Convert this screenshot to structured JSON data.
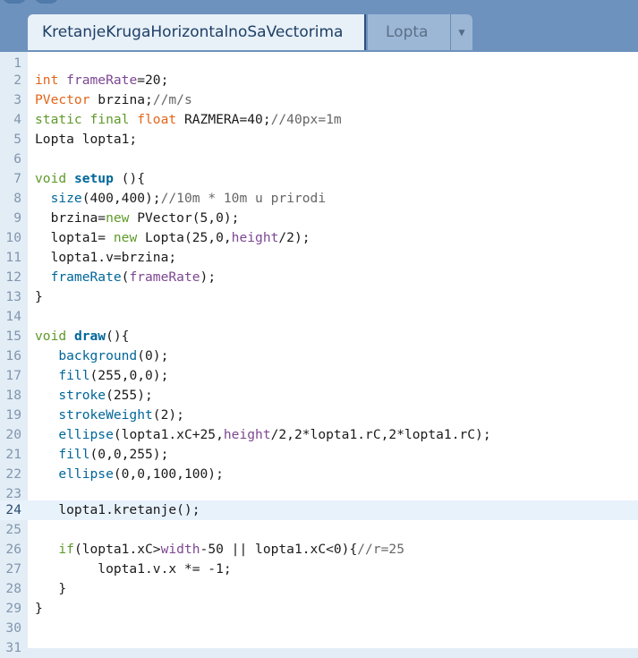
{
  "tabs": {
    "active": "KretanjeKrugaHorizontalnoSaVectorima",
    "inactive": "Lopta",
    "menu_glyph": "▼"
  },
  "code_lines": [
    {
      "n": "1",
      "text": ""
    },
    {
      "n": "2",
      "text": "int frameRate=20;"
    },
    {
      "n": "3",
      "text": "PVector brzina;//m/s"
    },
    {
      "n": "4",
      "text": "static final float RAZMERA=40;//40px=1m"
    },
    {
      "n": "5",
      "text": "Lopta lopta1;"
    },
    {
      "n": "6",
      "text": ""
    },
    {
      "n": "7",
      "text": "void setup (){"
    },
    {
      "n": "8",
      "text": "  size(400,400);//10m * 10m u prirodi"
    },
    {
      "n": "9",
      "text": "  brzina=new PVector(5,0);"
    },
    {
      "n": "10",
      "text": "  lopta1= new Lopta(25,0,height/2);"
    },
    {
      "n": "11",
      "text": "  lopta1.v=brzina;"
    },
    {
      "n": "12",
      "text": "  frameRate(frameRate);"
    },
    {
      "n": "13",
      "text": "}"
    },
    {
      "n": "14",
      "text": ""
    },
    {
      "n": "15",
      "text": "void draw(){"
    },
    {
      "n": "16",
      "text": "   background(0);"
    },
    {
      "n": "17",
      "text": "   fill(255,0,0);"
    },
    {
      "n": "18",
      "text": "   stroke(255);"
    },
    {
      "n": "19",
      "text": "   strokeWeight(2);"
    },
    {
      "n": "20",
      "text": "   ellipse(lopta1.xC+25,height/2,2*lopta1.rC,2*lopta1.rC);"
    },
    {
      "n": "21",
      "text": "   fill(0,0,255);"
    },
    {
      "n": "22",
      "text": "   ellipse(0,0,100,100);"
    },
    {
      "n": "23",
      "text": ""
    },
    {
      "n": "24",
      "text": "   lopta1.kretanje();"
    },
    {
      "n": "25",
      "text": ""
    },
    {
      "n": "26",
      "text": "   if(lopta1.xC>width-50 || lopta1.xC<0){//r=25"
    },
    {
      "n": "27",
      "text": "        lopta1.v.x *= -1;"
    },
    {
      "n": "28",
      "text": "   }"
    },
    {
      "n": "29",
      "text": "}"
    },
    {
      "n": "30",
      "text": ""
    },
    {
      "n": "31",
      "text": ""
    }
  ],
  "active_line": "24",
  "colors": {
    "keyword": "#e2661a",
    "type": "#5e9a29",
    "function": "#006699",
    "builtin_var": "#7d4793",
    "comment": "#666666",
    "active_line_bg": "#e8f2fb"
  }
}
